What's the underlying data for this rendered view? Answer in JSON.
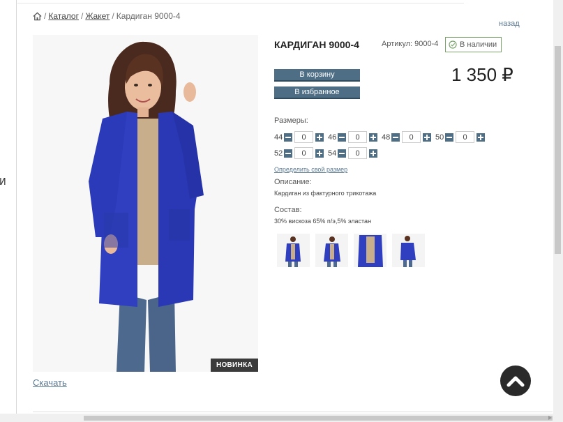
{
  "left_fragment": "И",
  "breadcrumb": {
    "items": [
      "Каталог",
      "Жакет"
    ],
    "separator": "/",
    "current": "Кардиган 9000-4"
  },
  "back_link": "назад",
  "product": {
    "title": "КАРДИГАН 9000-4",
    "sku": "Артикул: 9000-4",
    "stock": "В наличии",
    "price": "1 350 ₽",
    "badge": "НОВИНКА",
    "download": "Скачать"
  },
  "buttons": {
    "cart": "В корзину",
    "favorite": "В избранное"
  },
  "sizes": {
    "label": "Размеры:",
    "items": [
      {
        "size": "44",
        "qty": "0"
      },
      {
        "size": "46",
        "qty": "0"
      },
      {
        "size": "48",
        "qty": "0"
      },
      {
        "size": "50",
        "qty": "0"
      },
      {
        "size": "52",
        "qty": "0"
      },
      {
        "size": "54",
        "qty": "0"
      }
    ],
    "help_link": "Определить свой размер"
  },
  "description": {
    "label": "Описание:",
    "text": "Кардиган из фактурного трикотажа"
  },
  "composition": {
    "label": "Состав:",
    "text": "30% вискоза 65% п/э,5% эластан"
  },
  "colors": {
    "button": "#4d6e84",
    "link": "#5b7a93",
    "stock_border": "#7aa36a",
    "product": "#2f3fc0"
  }
}
